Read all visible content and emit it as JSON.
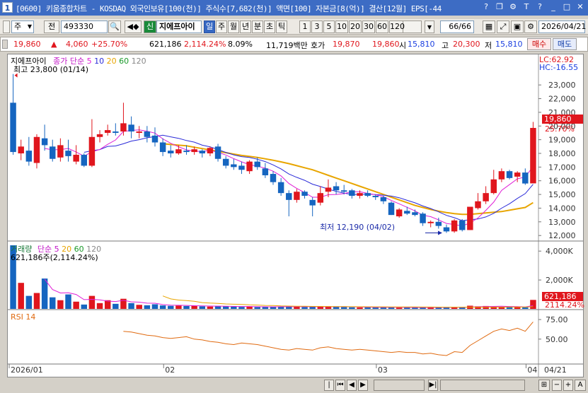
{
  "window": {
    "app_number": "1",
    "title": "[0600] 키움종합차트 - KOSDAQ 외국인보유[100(천)] 주식수[7,682(천)] 액면[100] 자본금[8(억)] 결산[12월] EPS[-44"
  },
  "toolbar": {
    "type_select": "주",
    "prev_label": "전",
    "code_value": "493330",
    "badge": "신",
    "stock_name": "지에프아이",
    "period_buttons": [
      "일",
      "주",
      "월",
      "년",
      "분",
      "초",
      "틱"
    ],
    "interval_buttons": [
      "1",
      "3",
      "5",
      "10",
      "20",
      "30",
      "60",
      "120"
    ],
    "page_counter": "66/66",
    "date_value": "2026/04/21"
  },
  "price_info": {
    "price": "19,860",
    "arrow": "▲",
    "change": "4,060",
    "change_pct": "+25.70%",
    "volume": "621,186",
    "volume_pct": "2,114.24%",
    "turnover": "8.09%",
    "amount": "11,719백만",
    "quote_label": "호가",
    "ask": "19,870",
    "bid": "19,860",
    "open_label": "시",
    "open": "15,810",
    "high_label": "고",
    "high": "20,300",
    "low_label": "저",
    "low": "15,810",
    "buy_button": "매수",
    "sell_button": "매도"
  },
  "price_panel": {
    "stock_label": "지에프아이",
    "legend_title": "종가 단순",
    "ma_periods": [
      "5",
      "10",
      "20",
      "60",
      "120"
    ],
    "ma_colors": [
      "#e01fd6",
      "#2a2ad8",
      "#e8a500",
      "#1a9a2a",
      "#888888"
    ],
    "max_annotation": "최고 23,800 (01/14)",
    "min_annotation": "최저 12,190 (04/02)",
    "lc": "LC:62.92",
    "hc": "HC:-16.55",
    "last_price_tag": "19,860",
    "last_pct_tag": "25.70%",
    "y_ticks": [
      "23,000",
      "22,000",
      "21,000",
      "20,000",
      "19,000",
      "18,000",
      "17,000",
      "16,000",
      "15,000",
      "14,000",
      "13,000",
      "12,000"
    ]
  },
  "volume_panel": {
    "legend_title": "거래량",
    "legend_ma": "단순",
    "ma_periods": [
      "5",
      "20",
      "60",
      "120"
    ],
    "last_label": "621,186주(2,114.24%)",
    "y_ticks": [
      "4,000K",
      "2,000K"
    ],
    "last_volume_tag": "621,186",
    "last_pct_tag": "2114.24%"
  },
  "rsi_panel": {
    "legend": "RSI 14",
    "y_ticks": [
      "75.00",
      "50.00"
    ]
  },
  "x_axis": {
    "labels": [
      "2026/01",
      "02",
      "03",
      "04"
    ],
    "right_label": "04/21"
  },
  "chart_data": {
    "type": "candlestick",
    "ohlc": [
      {
        "o": 21700,
        "h": 23800,
        "l": 17900,
        "c": 18100
      },
      {
        "o": 18000,
        "h": 19000,
        "l": 17500,
        "c": 18500
      },
      {
        "o": 18200,
        "h": 19200,
        "l": 17100,
        "c": 17400
      },
      {
        "o": 17300,
        "h": 19400,
        "l": 16900,
        "c": 19200
      },
      {
        "o": 19100,
        "h": 20100,
        "l": 18200,
        "c": 18600
      },
      {
        "o": 18500,
        "h": 19000,
        "l": 17400,
        "c": 17600
      },
      {
        "o": 17700,
        "h": 19100,
        "l": 17400,
        "c": 18600
      },
      {
        "o": 18200,
        "h": 19000,
        "l": 17400,
        "c": 17800
      },
      {
        "o": 17400,
        "h": 18600,
        "l": 17200,
        "c": 17900
      },
      {
        "o": 17900,
        "h": 18000,
        "l": 17000,
        "c": 17100
      },
      {
        "o": 17100,
        "h": 20500,
        "l": 17000,
        "c": 19200
      },
      {
        "o": 19200,
        "h": 19700,
        "l": 18800,
        "c": 19400
      },
      {
        "o": 19500,
        "h": 20100,
        "l": 19300,
        "c": 19700
      },
      {
        "o": 19600,
        "h": 20200,
        "l": 19300,
        "c": 19500
      },
      {
        "o": 19600,
        "h": 21700,
        "l": 19300,
        "c": 20200
      },
      {
        "o": 20100,
        "h": 20700,
        "l": 19100,
        "c": 19600
      },
      {
        "o": 19500,
        "h": 20000,
        "l": 19100,
        "c": 19600
      },
      {
        "o": 19600,
        "h": 20000,
        "l": 18800,
        "c": 19200
      },
      {
        "o": 19300,
        "h": 19900,
        "l": 18500,
        "c": 18800
      },
      {
        "o": 18800,
        "h": 19100,
        "l": 17800,
        "c": 18100
      },
      {
        "o": 18200,
        "h": 18600,
        "l": 17700,
        "c": 18000
      },
      {
        "o": 18000,
        "h": 18600,
        "l": 17900,
        "c": 18300
      },
      {
        "o": 18200,
        "h": 18600,
        "l": 17900,
        "c": 18100
      },
      {
        "o": 18100,
        "h": 18500,
        "l": 17900,
        "c": 18300
      },
      {
        "o": 18200,
        "h": 18300,
        "l": 17700,
        "c": 18000
      },
      {
        "o": 18000,
        "h": 18500,
        "l": 17800,
        "c": 18400
      },
      {
        "o": 18500,
        "h": 18700,
        "l": 17400,
        "c": 17600
      },
      {
        "o": 17600,
        "h": 17800,
        "l": 16900,
        "c": 17100
      },
      {
        "o": 17200,
        "h": 17600,
        "l": 16800,
        "c": 17000
      },
      {
        "o": 17100,
        "h": 17400,
        "l": 16500,
        "c": 16800
      },
      {
        "o": 16700,
        "h": 17500,
        "l": 16500,
        "c": 17400
      },
      {
        "o": 17400,
        "h": 17700,
        "l": 16800,
        "c": 17000
      },
      {
        "o": 16900,
        "h": 17300,
        "l": 16200,
        "c": 16400
      },
      {
        "o": 16500,
        "h": 16700,
        "l": 15700,
        "c": 15900
      },
      {
        "o": 15900,
        "h": 16200,
        "l": 14900,
        "c": 15100
      },
      {
        "o": 15100,
        "h": 15300,
        "l": 13400,
        "c": 14600
      },
      {
        "o": 14600,
        "h": 15400,
        "l": 14400,
        "c": 15200
      },
      {
        "o": 15200,
        "h": 15300,
        "l": 14700,
        "c": 14900
      },
      {
        "o": 14600,
        "h": 14800,
        "l": 13400,
        "c": 14200
      },
      {
        "o": 14400,
        "h": 15600,
        "l": 14200,
        "c": 15100
      },
      {
        "o": 15200,
        "h": 16100,
        "l": 14800,
        "c": 15500
      },
      {
        "o": 15600,
        "h": 15900,
        "l": 15000,
        "c": 15300
      },
      {
        "o": 15300,
        "h": 15700,
        "l": 15000,
        "c": 15200
      },
      {
        "o": 15300,
        "h": 15400,
        "l": 14700,
        "c": 14900
      },
      {
        "o": 14900,
        "h": 15300,
        "l": 14700,
        "c": 15100
      },
      {
        "o": 15100,
        "h": 15300,
        "l": 14800,
        "c": 14900
      },
      {
        "o": 14900,
        "h": 15000,
        "l": 14600,
        "c": 14800
      },
      {
        "o": 14800,
        "h": 14900,
        "l": 14300,
        "c": 14500
      },
      {
        "o": 14400,
        "h": 14500,
        "l": 13500,
        "c": 13500
      },
      {
        "o": 13400,
        "h": 14000,
        "l": 13300,
        "c": 13900
      },
      {
        "o": 13800,
        "h": 14100,
        "l": 13500,
        "c": 13600
      },
      {
        "o": 13700,
        "h": 13900,
        "l": 13400,
        "c": 13500
      },
      {
        "o": 13600,
        "h": 13700,
        "l": 12700,
        "c": 12900
      },
      {
        "o": 12900,
        "h": 13100,
        "l": 12600,
        "c": 13000
      },
      {
        "o": 13000,
        "h": 13300,
        "l": 12500,
        "c": 12700
      },
      {
        "o": 12600,
        "h": 12800,
        "l": 12190,
        "c": 12300
      },
      {
        "o": 12300,
        "h": 13200,
        "l": 12200,
        "c": 13100
      },
      {
        "o": 13100,
        "h": 13200,
        "l": 12300,
        "c": 12400
      },
      {
        "o": 12400,
        "h": 14100,
        "l": 12400,
        "c": 14100
      },
      {
        "o": 14000,
        "h": 15100,
        "l": 13900,
        "c": 14500
      },
      {
        "o": 14500,
        "h": 15600,
        "l": 14300,
        "c": 15100
      },
      {
        "o": 15100,
        "h": 16800,
        "l": 15000,
        "c": 16100
      },
      {
        "o": 16100,
        "h": 16900,
        "l": 15900,
        "c": 16700
      },
      {
        "o": 16700,
        "h": 16800,
        "l": 16100,
        "c": 16200
      },
      {
        "o": 16300,
        "h": 16700,
        "l": 15900,
        "c": 16600
      },
      {
        "o": 16600,
        "h": 16900,
        "l": 15700,
        "c": 15800
      },
      {
        "o": 15810,
        "h": 20300,
        "l": 15810,
        "c": 19860
      }
    ],
    "ma20": [
      null,
      null,
      null,
      null,
      null,
      null,
      null,
      null,
      null,
      null,
      null,
      null,
      null,
      null,
      null,
      null,
      null,
      null,
      null,
      18700,
      18650,
      18600,
      18550,
      18450,
      18350,
      18250,
      18150,
      18050,
      17950,
      17850,
      17780,
      17700,
      17600,
      17500,
      17380,
      17250,
      17100,
      16950,
      16800,
      16600,
      16400,
      16200,
      16000,
      15800,
      15600,
      15400,
      15200,
      15000,
      14800,
      14600,
      14400,
      14200,
      14050,
      13900,
      13780,
      13680,
      13600,
      13550,
      13550,
      13600,
      13650,
      13700,
      13750,
      13850,
      13950,
      14050,
      14400
    ],
    "rsi14": [
      null,
      null,
      null,
      null,
      null,
      null,
      null,
      null,
      null,
      null,
      null,
      null,
      null,
      null,
      60,
      59,
      57,
      55,
      54,
      52,
      51,
      52,
      53,
      50,
      49,
      47,
      46,
      44,
      43,
      45,
      44,
      43,
      41,
      39,
      37,
      36,
      38,
      37,
      36,
      39,
      40,
      38,
      37,
      36,
      37,
      36,
      35,
      34,
      33,
      34,
      33,
      33,
      31,
      32,
      30,
      29,
      34,
      33,
      42,
      48,
      54,
      60,
      63,
      61,
      64,
      60,
      72
    ],
    "volume_k": [
      4400,
      1800,
      900,
      1100,
      2100,
      800,
      600,
      1000,
      500,
      300,
      900,
      400,
      600,
      350,
      700,
      400,
      280,
      250,
      320,
      240,
      210,
      230,
      200,
      220,
      180,
      160,
      200,
      170,
      150,
      140,
      160,
      130,
      150,
      140,
      170,
      180,
      150,
      130,
      140,
      170,
      180,
      150,
      120,
      110,
      100,
      120,
      110,
      100,
      110,
      90,
      100,
      90,
      110,
      100,
      90,
      120,
      110,
      100,
      220,
      180,
      200,
      160,
      150,
      140,
      130,
      110,
      621
    ],
    "ylim": [
      11700,
      24300
    ],
    "volume_ylim": [
      0,
      4500
    ],
    "rsi_ylim": [
      20,
      85
    ],
    "up_color": "#e0161d",
    "down_color": "#1565c0"
  },
  "status_bar": {
    "zoom_out": "−",
    "zoom_in": "+",
    "auto_label": "A"
  }
}
